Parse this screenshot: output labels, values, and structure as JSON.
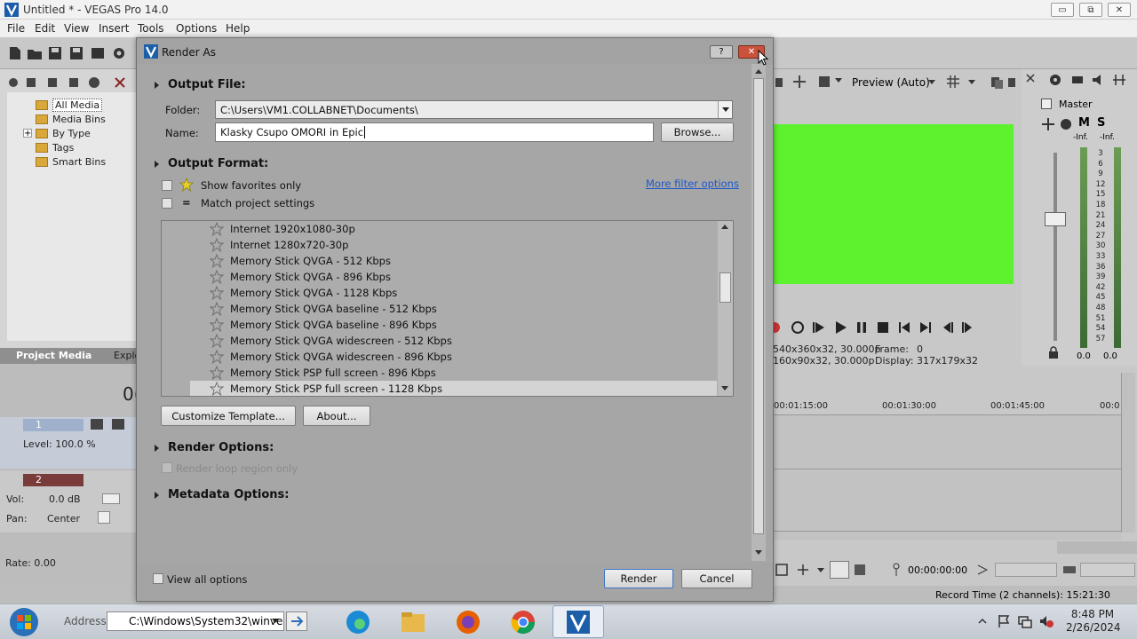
{
  "window": {
    "title": "Untitled * - VEGAS Pro 14.0",
    "minimize": "▭",
    "maximize": "⧉",
    "close": "✕"
  },
  "menu": [
    "File",
    "Edit",
    "View",
    "Insert",
    "Tools",
    "Options",
    "Help"
  ],
  "project_media": {
    "tree": [
      "All Media",
      "Media Bins",
      "By Type",
      "Tags",
      "Smart Bins"
    ],
    "expander": "+",
    "tabs": [
      "Project Media",
      "Explo"
    ]
  },
  "tracks": {
    "time_partial": "0(",
    "track1": {
      "number": "1",
      "level": "Level: 100.0 %"
    },
    "track2": {
      "number": "2",
      "vol_label": "Vol:",
      "vol_value": "0.0 dB",
      "pan_label": "Pan:",
      "pan_value": "Center"
    },
    "rate": "Rate: 0.00"
  },
  "preview": {
    "mode": "Preview (Auto)",
    "info_project_partial": "540x360x32, 30.000p",
    "info_preview_partial": "160x90x32, 30.000p",
    "frame_label": "Frame:",
    "frame_value": "0",
    "display_label": "Display:",
    "display_value": "317x179x32"
  },
  "master": {
    "title": "Master",
    "m": "M",
    "s": "S",
    "inf_left": "-Inf.",
    "inf_right": "-Inf.",
    "scale": [
      "3",
      "6",
      "9",
      "12",
      "15",
      "18",
      "21",
      "24",
      "27",
      "30",
      "33",
      "36",
      "39",
      "42",
      "45",
      "48",
      "51",
      "54",
      "57"
    ],
    "left_value": "0.0",
    "right_value": "0.0"
  },
  "timeline": {
    "ruler": [
      "00:01:15:00",
      "00:01:30:00",
      "00:01:45:00",
      "00:0"
    ],
    "timecode": "00:00:00:00"
  },
  "status": {
    "record_time": "Record Time (2 channels): 15:21:30"
  },
  "dialog": {
    "title": "Render As",
    "help_btn": "?",
    "close_btn": "✕",
    "output_file": {
      "heading": "Output File:",
      "folder_label": "Folder:",
      "folder_value": "C:\\Users\\VM1.COLLABNET\\Documents\\",
      "name_label": "Name:",
      "name_value": "Klasky Csupo OMORI in Epic",
      "browse": "Browse..."
    },
    "output_format": {
      "heading": "Output Format:",
      "show_favorites": "Show favorites only",
      "match_project": "Match project settings",
      "more_filter": "More filter options",
      "eq_symbol": "=",
      "templates": [
        "Internet 1920x1080-30p",
        "Internet 1280x720-30p",
        "Memory Stick QVGA - 512 Kbps",
        "Memory Stick QVGA - 896 Kbps",
        "Memory Stick QVGA - 1128 Kbps",
        "Memory Stick QVGA baseline - 512 Kbps",
        "Memory Stick QVGA baseline - 896 Kbps",
        "Memory Stick QVGA widescreen - 512 Kbps",
        "Memory Stick QVGA widescreen - 896 Kbps",
        "Memory Stick PSP full screen - 896 Kbps",
        "Memory Stick PSP full screen - 1128 Kbps"
      ],
      "selected_index": 10,
      "customize": "Customize Template...",
      "about": "About..."
    },
    "render_options": {
      "heading": "Render Options:",
      "loop_region": "Render loop region only"
    },
    "metadata_options": {
      "heading": "Metadata Options:"
    },
    "view_all": "View all options",
    "render": "Render",
    "cancel": "Cancel"
  },
  "taskbar": {
    "address_label": "Address",
    "address_value": "C:\\Windows\\System32\\winve",
    "time": "8:48 PM",
    "date": "2/26/2024"
  }
}
